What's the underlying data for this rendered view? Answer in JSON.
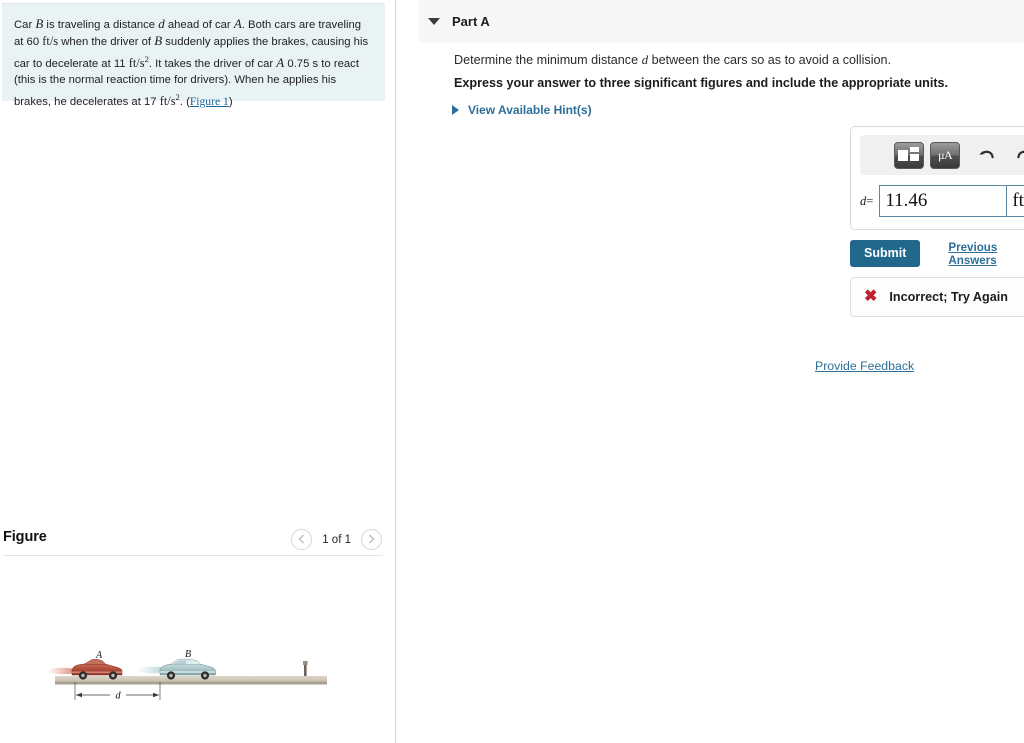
{
  "problem": {
    "segments": [
      {
        "t": "Car ",
        "k": "n"
      },
      {
        "t": "B",
        "k": "v"
      },
      {
        "t": " is traveling a distance ",
        "k": "n"
      },
      {
        "t": "d",
        "k": "v"
      },
      {
        "t": " ahead of car ",
        "k": "n"
      },
      {
        "t": "A",
        "k": "v"
      },
      {
        "t": ". Both cars are traveling at 60 ",
        "k": "n"
      },
      {
        "t": "ft/s",
        "k": "u"
      },
      {
        "t": " when the driver of ",
        "k": "n"
      },
      {
        "t": "B",
        "k": "v"
      },
      {
        "t": " suddenly applies the brakes, causing his car to decelerate at 11 ",
        "k": "n"
      },
      {
        "t": "ft/s²",
        "k": "u"
      },
      {
        "t": ". It takes the driver of car ",
        "k": "n"
      },
      {
        "t": "A",
        "k": "v"
      },
      {
        "t": " 0.75 s to react (this is the normal reaction time for drivers). When he applies his brakes, he decelerates at 17 ",
        "k": "n"
      },
      {
        "t": "ft/s²",
        "k": "u"
      },
      {
        "t": ". (",
        "k": "n"
      },
      {
        "t": "Figure 1",
        "k": "link"
      },
      {
        "t": ")",
        "k": "n"
      }
    ],
    "figure_link_label": "Figure 1"
  },
  "figure": {
    "title": "Figure",
    "nav": {
      "prev_icon": "chevron-left-icon",
      "next_icon": "chevron-right-icon",
      "count_label": "1 of 1"
    },
    "labels": {
      "car_a": "A",
      "car_b": "B",
      "distance": "d"
    },
    "colors": {
      "car_a": "#b04a3a",
      "car_b": "#a9c4c6",
      "road": "#d9d2c4"
    }
  },
  "part": {
    "title": "Part A",
    "caret_icon": "chevron-down-icon",
    "question": "Determine the minimum distance d between the cars so as to avoid a collision.",
    "question_pre": "Determine the minimum distance ",
    "question_var": "d",
    "question_post": " between the cars so as to avoid a collision.",
    "instruction": "Express your answer to three significant figures and include the appropriate units.",
    "hints_label": "View Available Hint(s)",
    "hints_icon": "triangle-right-icon"
  },
  "answer": {
    "label_var": "d",
    "label_eq": "=",
    "value": "11.46",
    "unit": "ft",
    "value_placeholder": "",
    "unit_placeholder": "",
    "toolbar": {
      "template_icon": "math-template-icon",
      "symbols_icon": "greek-symbols-icon",
      "symbols_label": "μA",
      "undo_icon": "undo-arrow-icon",
      "redo_icon": "redo-arrow-icon",
      "reset_icon": "reset-circle-icon",
      "keyboard_icon": "keyboard-icon",
      "help_icon": "question-mark-icon",
      "help_label": "?"
    }
  },
  "actions": {
    "submit_label": "Submit",
    "previous_answers_label": "Previous Answers",
    "provide_feedback_label": "Provide Feedback"
  },
  "feedback": {
    "icon": "x-mark-icon",
    "icon_glyph": "✖",
    "text": "Incorrect; Try Again",
    "color": "#c0212e"
  },
  "theme": {
    "accent": "#21688c",
    "link": "#2d6f99",
    "panel_bg": "#e9f3f4",
    "header_bg": "#f7f7f7"
  }
}
